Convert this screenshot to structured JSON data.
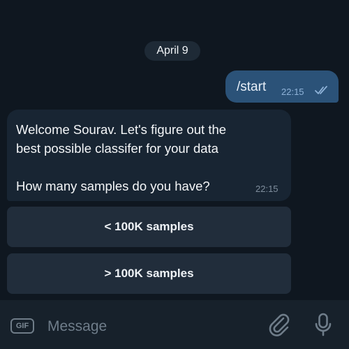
{
  "chat": {
    "date": "April 9",
    "outgoing": {
      "text": "/start",
      "time": "22:15"
    },
    "incoming": {
      "lines": [
        "Welcome Sourav. Let's figure out the",
        "best possible classifer for your data",
        "How many samples do you have?"
      ],
      "time": "22:15"
    },
    "keyboard": [
      {
        "label": "< 100K samples"
      },
      {
        "label": "> 100K samples"
      }
    ]
  },
  "composer": {
    "gif_label": "GIF",
    "placeholder": "Message",
    "icons": [
      "gif-icon",
      "attach-icon",
      "mic-icon"
    ]
  },
  "colors": {
    "background": "#0e1621",
    "outgoing_bubble": "#2b5278",
    "incoming_bubble": "#182533",
    "keyboard_button": "#212d3b",
    "composer": "#17212b"
  }
}
